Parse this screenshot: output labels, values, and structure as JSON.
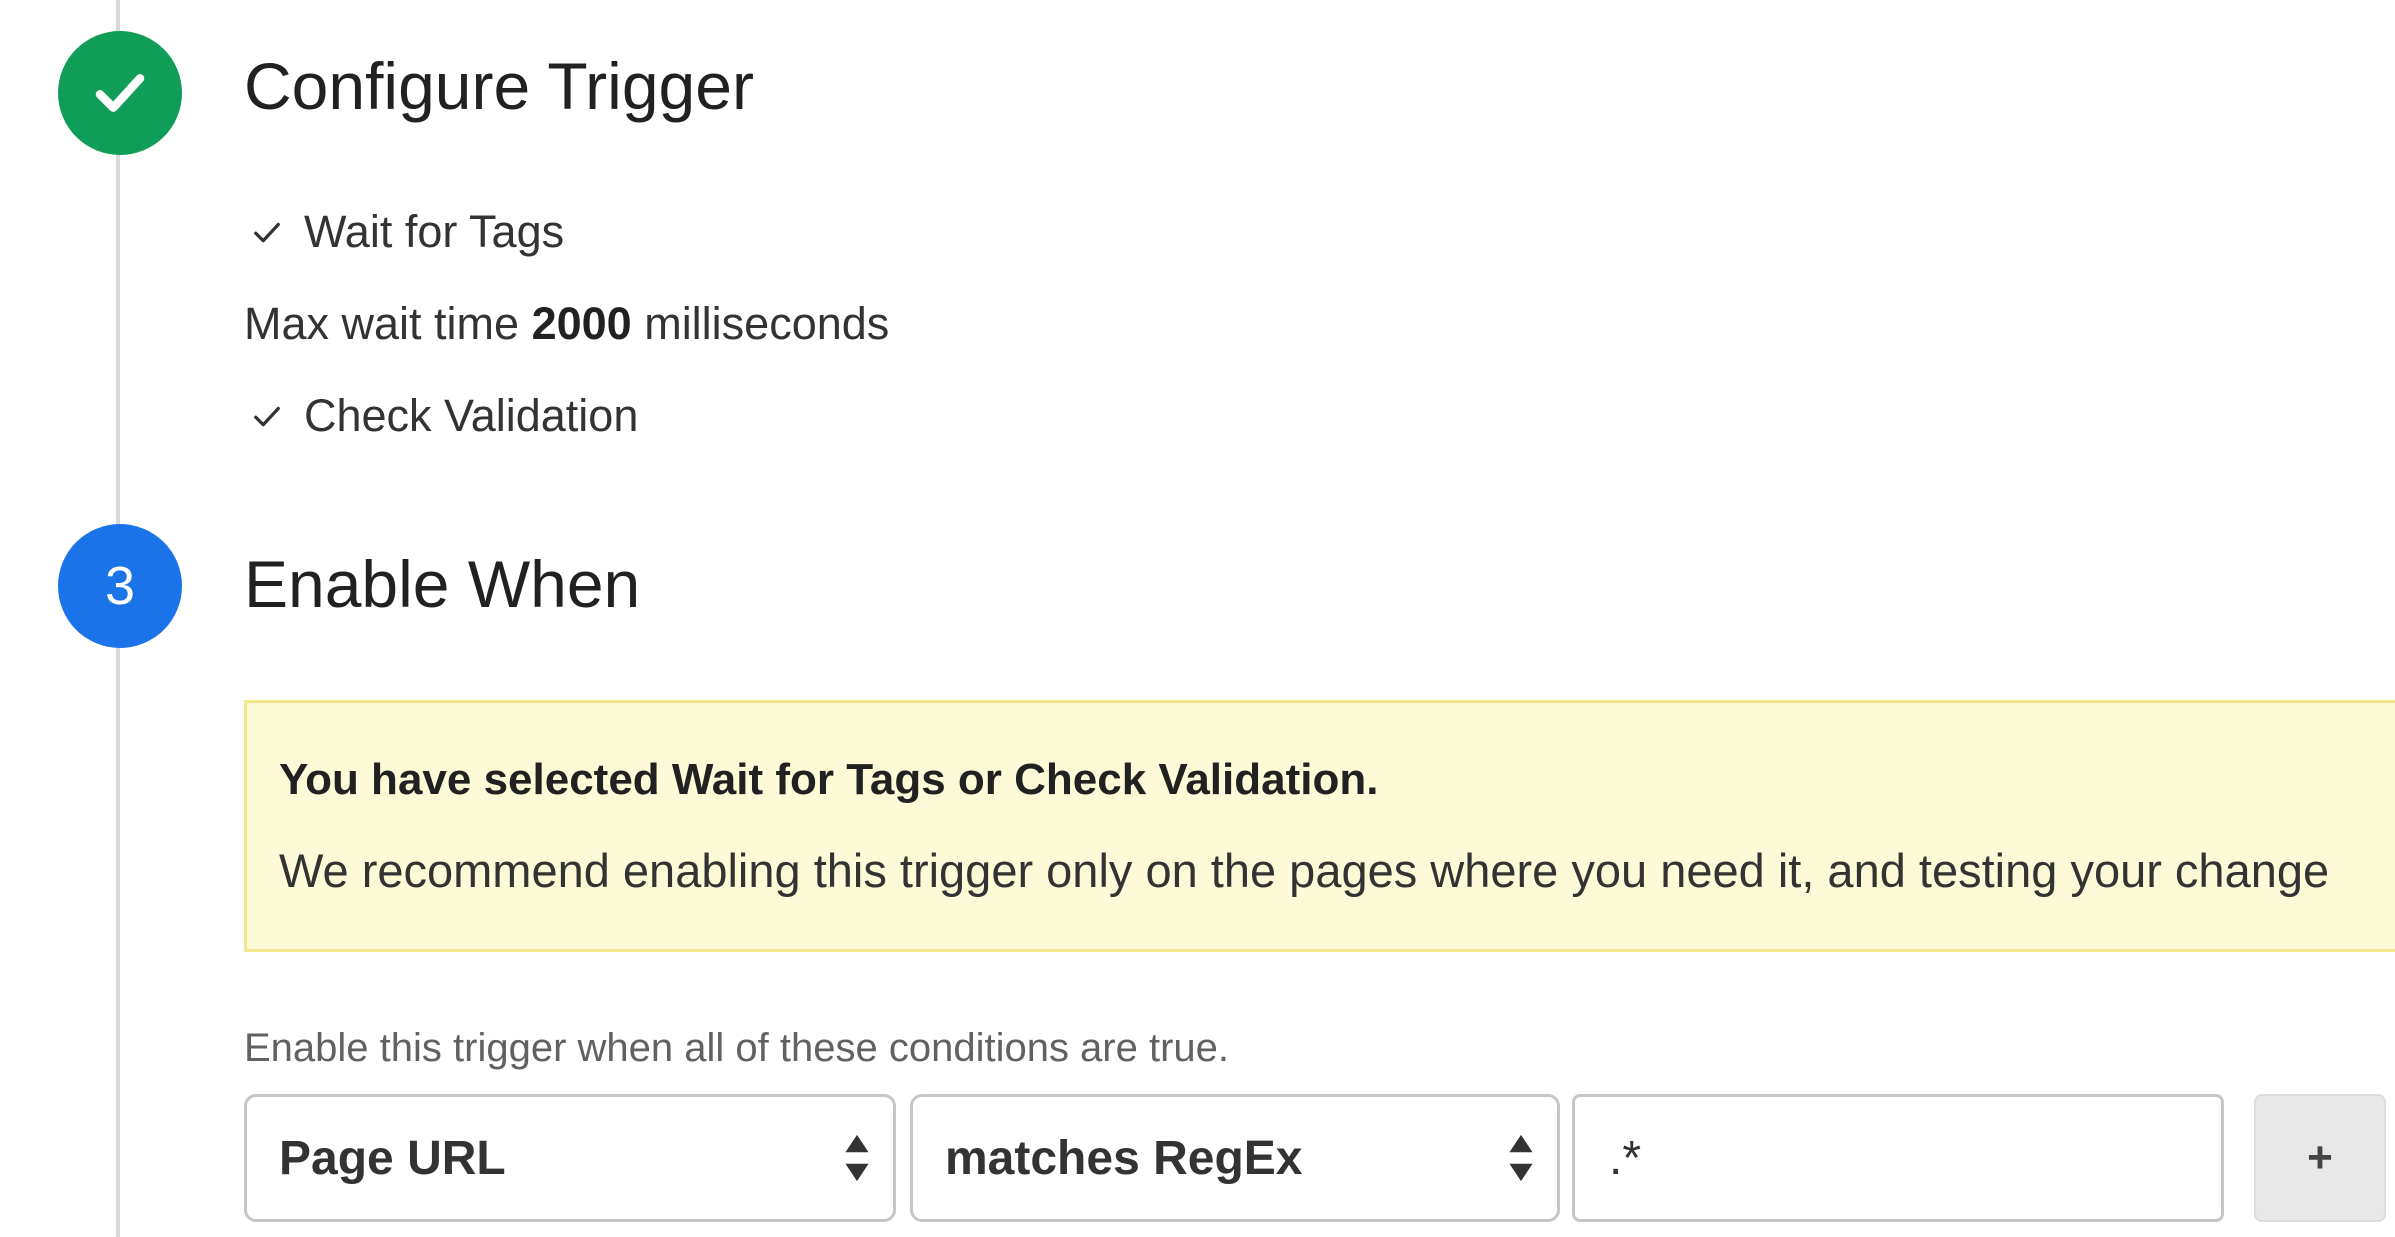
{
  "steps": {
    "configure": {
      "title": "Configure Trigger",
      "status": "complete",
      "options": {
        "wait_for_tags": "Wait for Tags",
        "max_wait_prefix": "Max wait time",
        "max_wait_value": "2000",
        "max_wait_unit": "milliseconds",
        "check_validation": "Check Validation"
      }
    },
    "enable_when": {
      "number": "3",
      "title": "Enable When",
      "warning": {
        "title": "You have selected Wait for Tags or Check Validation.",
        "body": "We recommend enabling this trigger only on the pages where you need it, and testing your change"
      },
      "conditions_label": "Enable this trigger when all of these conditions are true.",
      "condition": {
        "variable": "Page URL",
        "operator": "matches RegEx",
        "value": ".*"
      },
      "add_label": "+"
    }
  },
  "icons": {
    "completed_step": "checkmark-icon",
    "option_check": "check-icon",
    "select_arrows": "up-down-arrows-icon"
  },
  "colors": {
    "step_complete": "#0f9d58",
    "step_active": "#1a73e8",
    "warning_bg": "#fdfbd7",
    "warning_border": "#f0e68c"
  }
}
